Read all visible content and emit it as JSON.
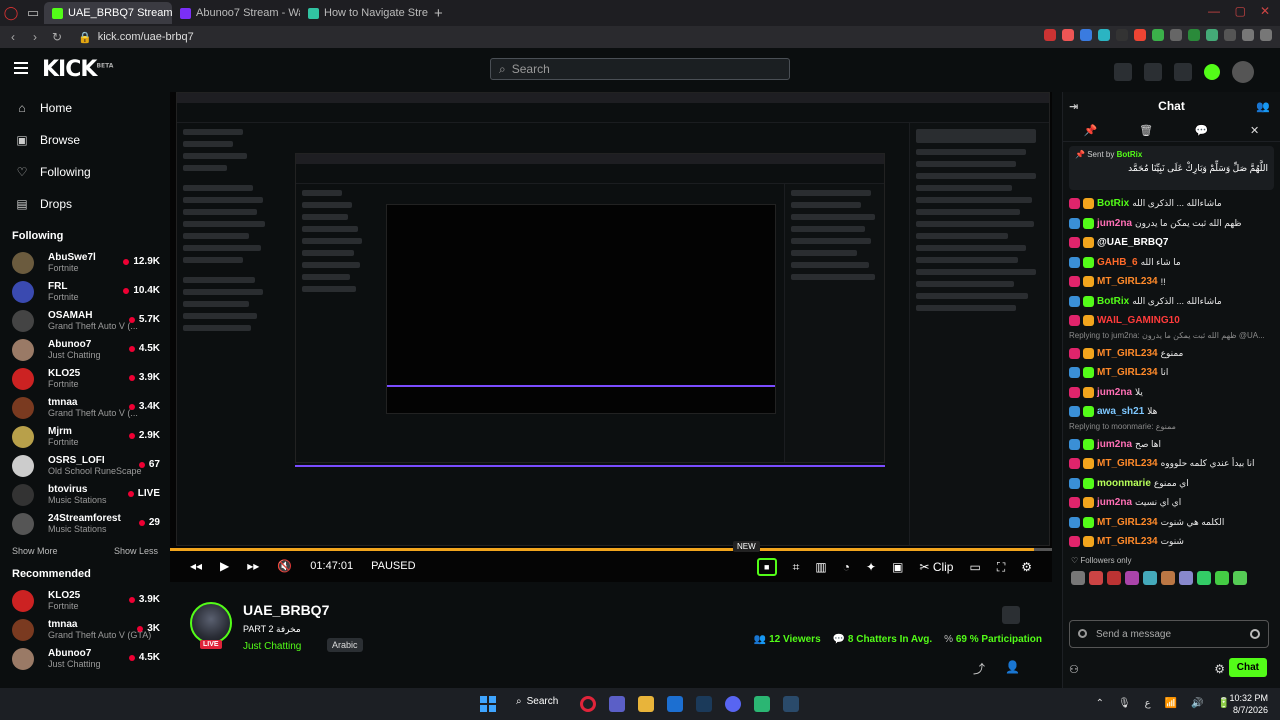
{
  "browser": {
    "tabs": [
      {
        "label": "UAE_BRBQ7 Stream - Watch",
        "active": true,
        "color": "#53fc18"
      },
      {
        "label": "Abunoo7 Stream - Watch L",
        "active": false,
        "color": "#7b2ff7"
      },
      {
        "label": "How to Navigate Streamlab",
        "active": false,
        "color": "#31c3a2"
      }
    ],
    "url": "kick.com/uae-brbq7"
  },
  "header": {
    "logo": "KICK",
    "logo_sup": "BETA",
    "search_placeholder": "Search"
  },
  "sidebar": {
    "nav": [
      {
        "label": "Home",
        "icon": "home-icon"
      },
      {
        "label": "Browse",
        "icon": "browse-icon"
      },
      {
        "label": "Following",
        "icon": "heart-icon"
      },
      {
        "label": "Drops",
        "icon": "drops-icon"
      }
    ],
    "following_title": "Following",
    "following": [
      {
        "name": "AbuSwe7l",
        "category": "Fortnite",
        "viewers": "12.9K",
        "color": "#6b5b3e"
      },
      {
        "name": "FRL",
        "category": "Fortnite",
        "viewers": "10.4K",
        "color": "#3a4ab0"
      },
      {
        "name": "OSAMAH",
        "category": "Grand Theft Auto V (...",
        "viewers": "5.7K",
        "color": "#444"
      },
      {
        "name": "Abunoo7",
        "category": "Just Chatting",
        "viewers": "4.5K",
        "color": "#9a7a66"
      },
      {
        "name": "KLO25",
        "category": "Fortnite",
        "viewers": "3.9K",
        "color": "#c22"
      },
      {
        "name": "tmnaa",
        "category": "Grand Theft Auto V (...",
        "viewers": "3.4K",
        "color": "#7a3a20"
      },
      {
        "name": "Mjrm",
        "category": "Fortnite",
        "viewers": "2.9K",
        "color": "#b8a04a"
      },
      {
        "name": "OSRS_LOFI",
        "category": "Old School RuneScape",
        "viewers": "67",
        "color": "#ccc"
      },
      {
        "name": "btovirus",
        "category": "Music Stations",
        "viewers": "LIVE",
        "color": "#333"
      },
      {
        "name": "24Streamforest",
        "category": "Music Stations",
        "viewers": "29",
        "color": "#555"
      }
    ],
    "show_more": "Show More",
    "show_less": "Show Less",
    "recommended_title": "Recommended",
    "recommended": [
      {
        "name": "KLO25",
        "category": "Fortnite",
        "viewers": "3.9K",
        "color": "#c22"
      },
      {
        "name": "tmnaa",
        "category": "Grand Theft Auto V (GTA)",
        "viewers": "3K",
        "color": "#7a3a20"
      },
      {
        "name": "Abunoo7",
        "category": "Just Chatting",
        "viewers": "4.5K",
        "color": "#9a7a66"
      }
    ]
  },
  "player": {
    "time": "01:47:01",
    "state": "PAUSED",
    "new_badge": "NEW",
    "clip_label": "Clip",
    "progress": 0.98
  },
  "stream": {
    "channel": "UAE_BRBQ7",
    "title": "PART 2 مخرفة",
    "category": "Just Chatting",
    "language": "Arabic",
    "live": "LIVE",
    "viewers": "12",
    "viewers_label": "Viewers",
    "chatters": "8",
    "chatters_label": "Chatters In Avg.",
    "participation": "69 %",
    "participation_label": "Participation"
  },
  "chat": {
    "title": "Chat",
    "pinned_by_label": "Sent by",
    "pinned_by": "BotRix",
    "pinned_text": "اللَّهُمَّ صَلِّ وَسَلِّمْ وَبَارِكْ عَلَى نَبِيِّنَا مُحَمَّد",
    "messages": [
      {
        "type": "msg",
        "user": "BotRix",
        "color": "#53fc18",
        "text": "ماشاءالله ... الذكرى الله"
      },
      {
        "type": "msg",
        "user": "jum2na",
        "color": "#ff6fb5",
        "text": "ظهم الله ثبت يمكن ما يدرون"
      },
      {
        "type": "msg",
        "user": "@UAE_BRBQ7",
        "color": "#ffffff",
        "text": ""
      },
      {
        "type": "msg",
        "user": "GAHB_6",
        "color": "#ff6a2a",
        "text": "ما شاء الله"
      },
      {
        "type": "msg",
        "user": "MT_GIRL234",
        "color": "#ff8a2a",
        "text": "!!"
      },
      {
        "type": "msg",
        "user": "BotRix",
        "color": "#53fc18",
        "text": "ماشاءالله ... الذكرى الله"
      },
      {
        "type": "msg",
        "user": "WAIL_GAMING10",
        "color": "#ff3b3b",
        "text": ""
      },
      {
        "type": "reply",
        "text": "Replying to jum2na: ظهم الله ثبت يمكن ما يدرون @UA..."
      },
      {
        "type": "msg",
        "user": "MT_GIRL234",
        "color": "#ff8a2a",
        "text": "ممنوع"
      },
      {
        "type": "msg",
        "user": "MT_GIRL234",
        "color": "#ff8a2a",
        "text": "انا"
      },
      {
        "type": "msg",
        "user": "jum2na",
        "color": "#ff6fb5",
        "text": "يلا"
      },
      {
        "type": "msg",
        "user": "awa_sh21",
        "color": "#7ec8ff",
        "text": "هلا"
      },
      {
        "type": "reply",
        "text": "Replying to moonmarie: ممنوع"
      },
      {
        "type": "msg",
        "user": "jum2na",
        "color": "#ff6fb5",
        "text": "اها صح"
      },
      {
        "type": "msg",
        "user": "MT_GIRL234",
        "color": "#ff8a2a",
        "text": "انا بيدأ عندي كلمه حلوووه"
      },
      {
        "type": "msg",
        "user": "moonmarie",
        "color": "#b7ff5a",
        "text": "اي ممنوع"
      },
      {
        "type": "msg",
        "user": "jum2na",
        "color": "#ff6fb5",
        "text": "اي اي نسيت"
      },
      {
        "type": "msg",
        "user": "MT_GIRL234",
        "color": "#ff8a2a",
        "text": "الكلمه هي شنوت"
      },
      {
        "type": "msg",
        "user": "MT_GIRL234",
        "color": "#ff8a2a",
        "text": "شنوت"
      }
    ],
    "followers_only": "Followers only",
    "input_placeholder": "Send a message",
    "send_label": "Chat"
  },
  "taskbar": {
    "search_label": "Search",
    "time": "10:32 PM",
    "date": "8/7/2026"
  }
}
